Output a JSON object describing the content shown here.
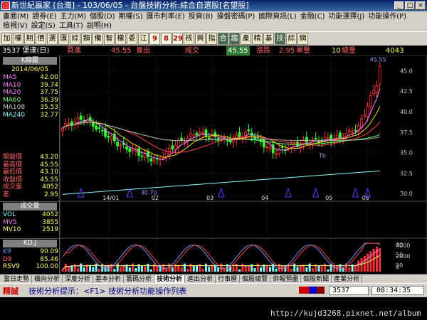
{
  "window": {
    "title": "新世紀贏家 [台灣] - 103/06/05 - 台盤技術分析:綜合自選股[名望股]",
    "min": "_",
    "max": "□",
    "close": "×"
  },
  "menu": {
    "row1": [
      "畫面(M)",
      "證券(E)",
      "主力(M)",
      "個股(D)",
      "期權(S)",
      "匯市利率(E)",
      "投資(B)",
      "操盤密碼(P)",
      "國際資訊(L)",
      "金融(C)",
      "功能選擇(J)",
      "功能操作(P)"
    ],
    "row2": [
      "檢視(V)",
      "設定(S)",
      "工具(T)",
      "說明(H)"
    ]
  },
  "toolbar": [
    "加",
    "權",
    "期",
    "價",
    "選",
    "匯",
    "綜",
    "類",
    "備",
    "智",
    "權",
    "委",
    "江",
    "9",
    "8",
    "29",
    "核",
    "興",
    "指",
    "合",
    "趨",
    "產",
    "精",
    "基",
    "技",
    "綜",
    "網"
  ],
  "info": {
    "code": "3537 堡達(日)",
    "buy_label": "買進",
    "buy": "45.55",
    "sell_label": "賣出",
    "change_label": "成交",
    "change": "45.55",
    "rise_label": "漲跌",
    "rise": "2.95",
    "vol_label": "單量",
    "vol": "10",
    "total_label": "總量",
    "total": "4043"
  },
  "sidebar": {
    "title": "K線圖",
    "date": "2014/06/05",
    "ma": [
      {
        "k": "MA5",
        "v": "42.00",
        "c": "#ff7fff"
      },
      {
        "k": "MA10",
        "v": "39.74",
        "c": "#ff7fff"
      },
      {
        "k": "MA20",
        "v": "37.75",
        "c": "#ff7fff"
      },
      {
        "k": "MA60",
        "v": "36.39",
        "c": "#7fff7f"
      },
      {
        "k": "MA108",
        "v": "35.53",
        "c": "#cccccc"
      },
      {
        "k": "MA240",
        "v": "32.77",
        "c": "#7fffff"
      }
    ],
    "quote": [
      {
        "k": "開盤價",
        "v": "43.20",
        "c": "#ff6666"
      },
      {
        "k": "最高價",
        "v": "45.55",
        "c": "#ff6666"
      },
      {
        "k": "最低價",
        "v": "43.10",
        "c": "#ff6666"
      },
      {
        "k": "收盤價",
        "v": "45.55",
        "c": "#ff6666"
      },
      {
        "k": "成交量",
        "v": "4052",
        "c": "#ff6666"
      },
      {
        "k": "差",
        "v": "2.95",
        "c": "#ff6666"
      }
    ]
  },
  "volume": {
    "title": "成交量",
    "items": [
      {
        "k": "VOL",
        "v": "4052",
        "c": "#7fffff"
      },
      {
        "k": "MV5",
        "v": "3855",
        "c": "#ff7fff"
      },
      {
        "k": "MV10",
        "v": "2519",
        "c": "#ffff7f"
      }
    ]
  },
  "kd": {
    "title": "KD,J",
    "items": [
      {
        "k": "K9",
        "v": "90.09",
        "c": "#6699ff"
      },
      {
        "k": "D9",
        "v": "85.46",
        "c": "#ff6666"
      },
      {
        "k": "RSV9",
        "v": "100.00",
        "c": "#ffff66"
      }
    ]
  },
  "chart": {
    "y_ticks": [
      "45.0",
      "42.5",
      "40.0",
      "37.5",
      "35.0",
      "32.5",
      "30.0"
    ],
    "high_label": "45.55",
    "low_label": "30.70",
    "x_ticks": [
      "14/01",
      "02",
      "03",
      "04",
      "05",
      "06"
    ],
    "vol_ticks": [
      "4000",
      "2000",
      "0"
    ],
    "kd_ticks": [
      "80",
      "50",
      "20"
    ],
    "tb_label": "Tb"
  },
  "tabs": [
    "當日走勢",
    "橫向分析",
    "深度分析",
    "基本分析",
    "籌碼分析",
    "技術分析",
    "進出分析",
    "行事曆",
    "個股總覽",
    "併報預盡",
    "個股新聞",
    "產業分析"
  ],
  "status": {
    "left": "精誠",
    "hint": "技術分析提示：<F1> 技術分析功能操作列表",
    "code": "3537",
    "time": "08:34:35"
  },
  "watermark": "http://kujd3268.pixnet.net/album",
  "chart_data": {
    "type": "candlestick",
    "x_ticks": [
      "14/01",
      "02",
      "03",
      "04",
      "05",
      "06"
    ],
    "y_range": [
      29.5,
      46.5
    ],
    "last": {
      "open": 43.2,
      "high": 45.55,
      "low": 43.1,
      "close": 45.55,
      "volume": 4052
    },
    "ma_last": {
      "MA5": 42.0,
      "MA10": 39.74,
      "MA20": 37.75,
      "MA60": 36.39,
      "MA108": 35.53,
      "MA240": 32.77
    },
    "vol_range": [
      0,
      5000
    ],
    "kd_last": {
      "K9": 90.09,
      "D9": 85.46,
      "RSV9": 100.0
    }
  }
}
